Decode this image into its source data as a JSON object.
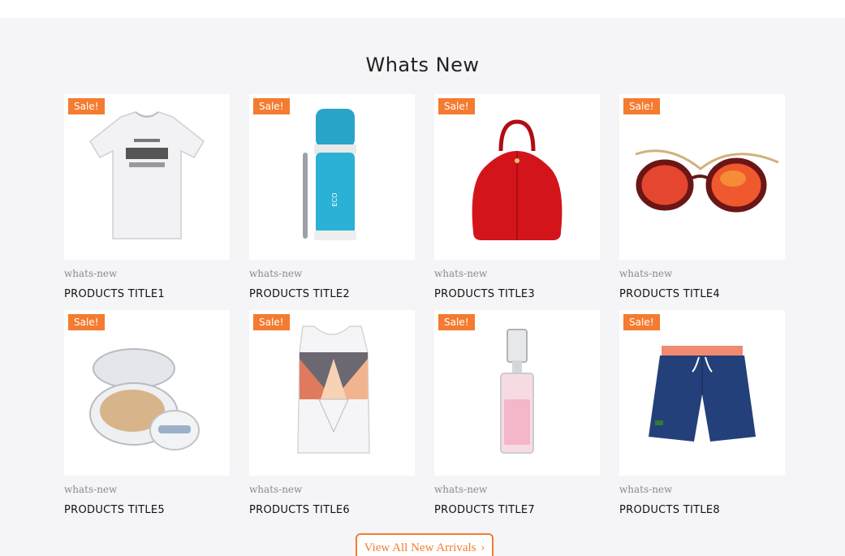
{
  "section": {
    "title": "Whats New"
  },
  "badge_color": "#f47b30",
  "products": [
    {
      "badge": "Sale!",
      "category": "whats-new",
      "title": "PRODUCTS TITLE1",
      "image_icon": "tshirt-icon"
    },
    {
      "badge": "Sale!",
      "category": "whats-new",
      "title": "PRODUCTS TITLE2",
      "image_icon": "thermos-bottle-icon"
    },
    {
      "badge": "Sale!",
      "category": "whats-new",
      "title": "PRODUCTS TITLE3",
      "image_icon": "handbag-icon"
    },
    {
      "badge": "Sale!",
      "category": "whats-new",
      "title": "PRODUCTS TITLE4",
      "image_icon": "sunglasses-icon"
    },
    {
      "badge": "Sale!",
      "category": "whats-new",
      "title": "PRODUCTS TITLE5",
      "image_icon": "cushion-compact-icon"
    },
    {
      "badge": "Sale!",
      "category": "whats-new",
      "title": "PRODUCTS TITLE6",
      "image_icon": "tank-top-icon"
    },
    {
      "badge": "Sale!",
      "category": "whats-new",
      "title": "PRODUCTS TITLE7",
      "image_icon": "perfume-bottle-icon"
    },
    {
      "badge": "Sale!",
      "category": "whats-new",
      "title": "PRODUCTS TITLE8",
      "image_icon": "swim-shorts-icon"
    }
  ],
  "view_all": {
    "label": "View All New Arrivals",
    "icon": "chevron-right-icon"
  }
}
